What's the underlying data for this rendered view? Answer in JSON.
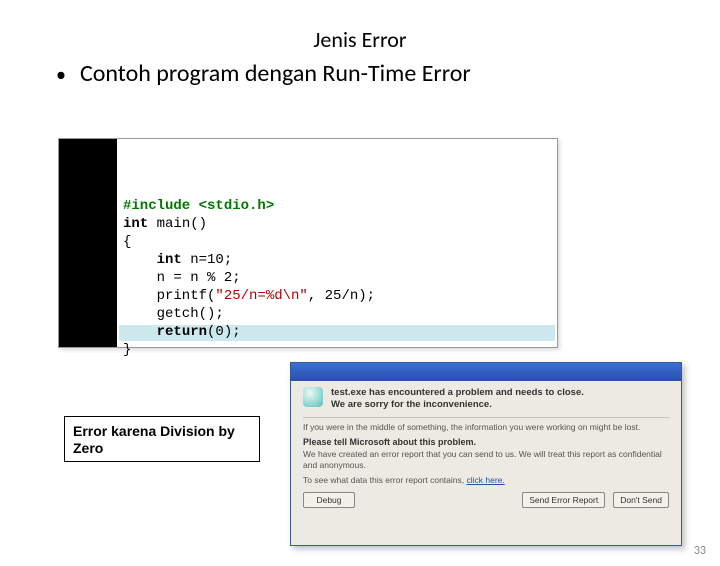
{
  "title": "Jenis Error",
  "bullet": "Contoh program dengan Run-Time Error",
  "code": {
    "line1_pre": "#include ",
    "line1_inc": "<stdio.h>",
    "line2_kw": "int",
    "line2_rest": " main()",
    "line3": "{",
    "line4_indent": "    ",
    "line4_kw": "int",
    "line4_rest": " n=10;",
    "line5": "    n = n % 2;",
    "line6_a": "    printf(",
    "line6_str": "\"25/n=%d\\n\"",
    "line6_b": ", 25/n);",
    "line7": "    getch();",
    "line8_a": "    ",
    "line8_kw": "return",
    "line8_b": "(0);",
    "line9": "}"
  },
  "caption": "Error karena Division by Zero",
  "dialog": {
    "head1": "test.exe has encountered a problem and needs to close.",
    "head2": "We are sorry for the inconvenience.",
    "para1": "If you were in the middle of something, the information you were working on might be lost.",
    "subhead": "Please tell Microsoft about this problem.",
    "para2": "We have created an error report that you can send to us. We will treat this report as confidential and anonymous.",
    "linkprefix": "To see what data this error report contains, ",
    "linktext": "click here.",
    "btn_debug": "Debug",
    "btn_send": "Send Error Report",
    "btn_dont": "Don't Send"
  },
  "pagenum": "33"
}
